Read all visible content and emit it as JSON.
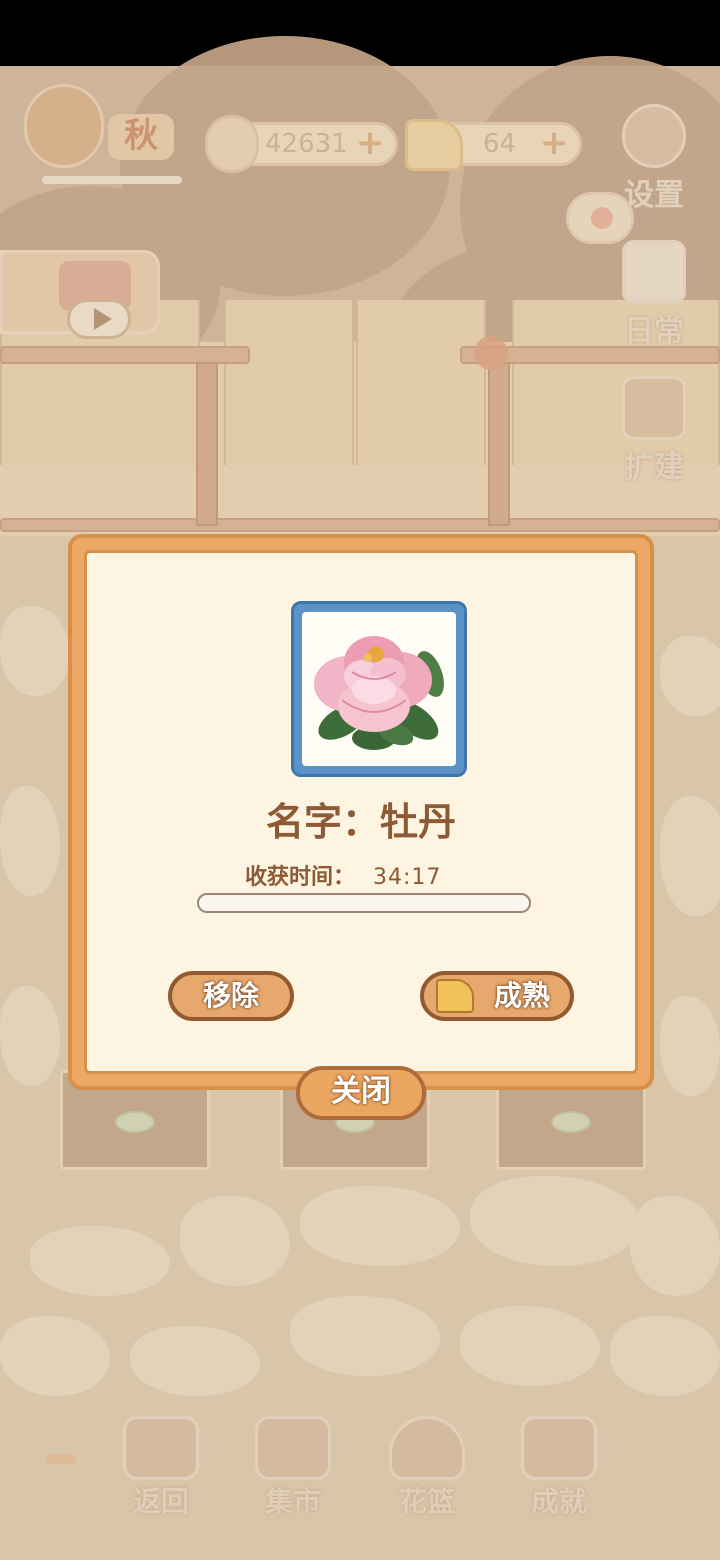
{
  "hud": {
    "season_label": "秋",
    "fish_count": "42631",
    "cheese_count": "64",
    "add_symbol": "+"
  },
  "side_menu": {
    "settings_label": "设置",
    "daily_label": "日常",
    "expand_label": "扩建"
  },
  "dialog": {
    "name_text": "名字：牡丹",
    "harvest_time_label": "收获时间：",
    "harvest_time_value": "34:17",
    "progress_fraction": 0.0,
    "remove_label": "移除",
    "mature_label": "成熟",
    "close_label": "关闭"
  },
  "bottom_nav": {
    "back_label": "返回",
    "market_label": "集市",
    "basket_label": "花篮",
    "achievement_label": "成就"
  },
  "icons": {
    "fish": "fish-bone-icon",
    "cheese": "cheese-icon",
    "settings": "gear-icon",
    "daily": "notebook-icon",
    "expand": "hammer-icon",
    "watering": "watering-can-icon",
    "play": "play-icon",
    "flower": "peony-flower-icon"
  },
  "colors": {
    "dialog_border": "#eda865",
    "dialog_panel": "#fdf5e1",
    "text_brown": "#8c5a36",
    "portrait_frame": "#5b93c7"
  }
}
